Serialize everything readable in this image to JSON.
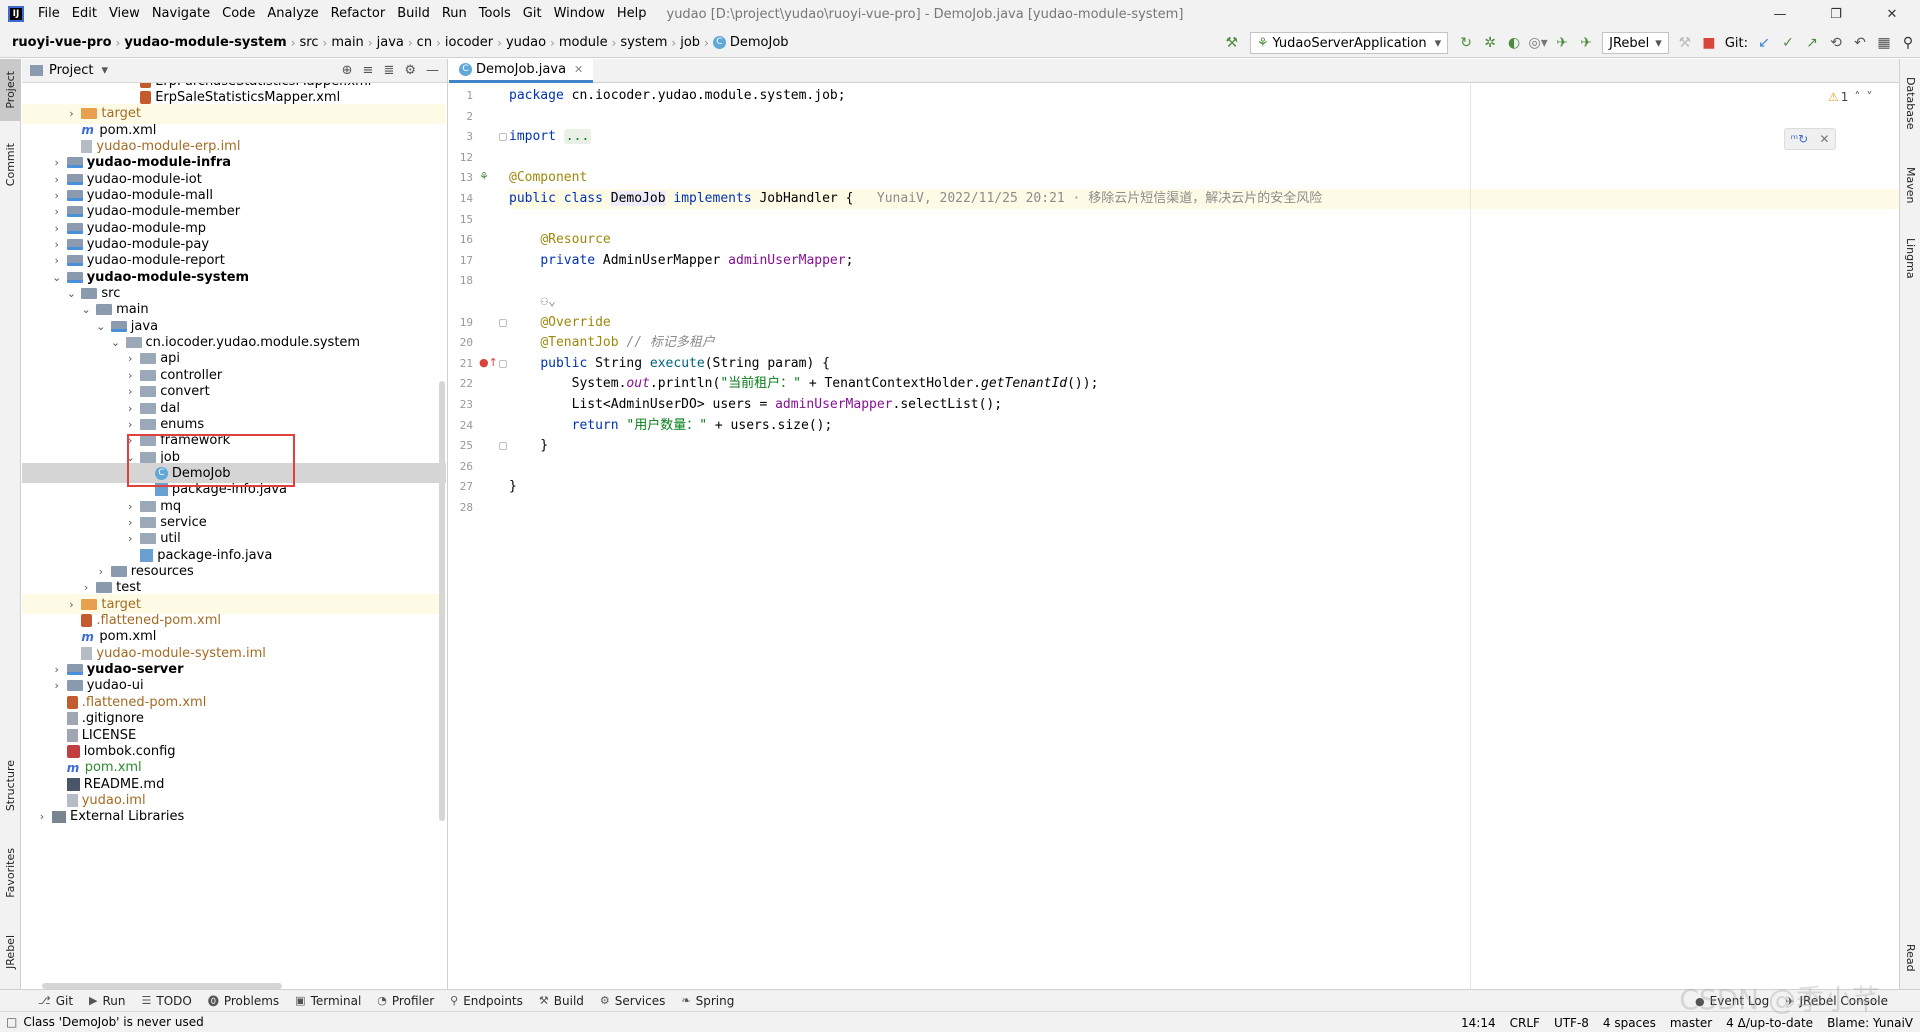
{
  "menubar": {
    "logo": "IJ",
    "items": [
      "File",
      "Edit",
      "View",
      "Navigate",
      "Code",
      "Analyze",
      "Refactor",
      "Build",
      "Run",
      "Tools",
      "Git",
      "Window",
      "Help"
    ],
    "title": "yudao [D:\\project\\yudao\\ruoyi-vue-pro] - DemoJob.java [yudao-module-system]"
  },
  "navbar": {
    "crumbs": [
      "ruoyi-vue-pro",
      "yudao-module-system",
      "src",
      "main",
      "java",
      "cn",
      "iocoder",
      "yudao",
      "module",
      "system",
      "job",
      "DemoJob"
    ],
    "run_config": "YudaoServerApplication",
    "jrebel": "JRebel",
    "git_label": "Git:"
  },
  "left_strip": [
    "Project",
    "Commit",
    "Structure",
    "Favorites",
    "JRebel"
  ],
  "right_strip": [
    "Database",
    "Maven",
    "Lingma",
    "Read"
  ],
  "project": {
    "title": "Project",
    "tree": [
      {
        "label": "ErpPurchaseStatisticsMapper.xml",
        "icon": "xml",
        "indent": 6,
        "chev": "",
        "style": ""
      },
      {
        "label": "ErpSaleStatisticsMapper.xml",
        "icon": "xml",
        "indent": 6,
        "chev": "",
        "style": ""
      },
      {
        "label": "target",
        "icon": "folder-orange",
        "indent": 2,
        "chev": "›",
        "style": "orange",
        "row": "hl-yellow"
      },
      {
        "label": "pom.xml",
        "icon": "maven",
        "indent": 2,
        "chev": "",
        "style": ""
      },
      {
        "label": "yudao-module-erp.iml",
        "icon": "iml",
        "indent": 2,
        "chev": "",
        "style": "orange"
      },
      {
        "label": "yudao-module-infra",
        "icon": "module",
        "indent": 1,
        "chev": "›",
        "style": "bold"
      },
      {
        "label": "yudao-module-iot",
        "icon": "module",
        "indent": 1,
        "chev": "›",
        "style": ""
      },
      {
        "label": "yudao-module-mall",
        "icon": "module",
        "indent": 1,
        "chev": "›",
        "style": ""
      },
      {
        "label": "yudao-module-member",
        "icon": "module",
        "indent": 1,
        "chev": "›",
        "style": ""
      },
      {
        "label": "yudao-module-mp",
        "icon": "module",
        "indent": 1,
        "chev": "›",
        "style": ""
      },
      {
        "label": "yudao-module-pay",
        "icon": "module",
        "indent": 1,
        "chev": "›",
        "style": ""
      },
      {
        "label": "yudao-module-report",
        "icon": "module",
        "indent": 1,
        "chev": "›",
        "style": ""
      },
      {
        "label": "yudao-module-system",
        "icon": "module",
        "indent": 1,
        "chev": "⌄",
        "style": "bold"
      },
      {
        "label": "src",
        "icon": "folder",
        "indent": 2,
        "chev": "⌄",
        "style": ""
      },
      {
        "label": "main",
        "icon": "folder",
        "indent": 3,
        "chev": "⌄",
        "style": ""
      },
      {
        "label": "java",
        "icon": "module",
        "indent": 4,
        "chev": "⌄",
        "style": ""
      },
      {
        "label": "cn.iocoder.yudao.module.system",
        "icon": "pkg",
        "indent": 5,
        "chev": "⌄",
        "style": ""
      },
      {
        "label": "api",
        "icon": "pkg",
        "indent": 6,
        "chev": "›",
        "style": ""
      },
      {
        "label": "controller",
        "icon": "pkg",
        "indent": 6,
        "chev": "›",
        "style": ""
      },
      {
        "label": "convert",
        "icon": "pkg",
        "indent": 6,
        "chev": "›",
        "style": ""
      },
      {
        "label": "dal",
        "icon": "pkg",
        "indent": 6,
        "chev": "›",
        "style": ""
      },
      {
        "label": "enums",
        "icon": "pkg",
        "indent": 6,
        "chev": "›",
        "style": ""
      },
      {
        "label": "framework",
        "icon": "pkg",
        "indent": 6,
        "chev": "›",
        "style": ""
      },
      {
        "label": "job",
        "icon": "pkg",
        "indent": 6,
        "chev": "⌄",
        "style": ""
      },
      {
        "label": "DemoJob",
        "icon": "cls",
        "indent": 7,
        "chev": "",
        "style": "",
        "row": "selected"
      },
      {
        "label": "package-info.java",
        "icon": "java",
        "indent": 7,
        "chev": "",
        "style": ""
      },
      {
        "label": "mq",
        "icon": "pkg",
        "indent": 6,
        "chev": "›",
        "style": ""
      },
      {
        "label": "service",
        "icon": "pkg",
        "indent": 6,
        "chev": "›",
        "style": ""
      },
      {
        "label": "util",
        "icon": "pkg",
        "indent": 6,
        "chev": "›",
        "style": ""
      },
      {
        "label": "package-info.java",
        "icon": "java",
        "indent": 6,
        "chev": "",
        "style": ""
      },
      {
        "label": "resources",
        "icon": "folder",
        "indent": 4,
        "chev": "›",
        "style": ""
      },
      {
        "label": "test",
        "icon": "folder",
        "indent": 3,
        "chev": "›",
        "style": ""
      },
      {
        "label": "target",
        "icon": "folder-orange",
        "indent": 2,
        "chev": "›",
        "style": "orange",
        "row": "hl-yellow"
      },
      {
        "label": ".flattened-pom.xml",
        "icon": "xml",
        "indent": 2,
        "chev": "",
        "style": "orange"
      },
      {
        "label": "pom.xml",
        "icon": "maven",
        "indent": 2,
        "chev": "",
        "style": ""
      },
      {
        "label": "yudao-module-system.iml",
        "icon": "iml",
        "indent": 2,
        "chev": "",
        "style": "orange"
      },
      {
        "label": "yudao-server",
        "icon": "module",
        "indent": 1,
        "chev": "›",
        "style": "bold"
      },
      {
        "label": "yudao-ui",
        "icon": "folder",
        "indent": 1,
        "chev": "›",
        "style": ""
      },
      {
        "label": ".flattened-pom.xml",
        "icon": "xml",
        "indent": 1,
        "chev": "",
        "style": "orange"
      },
      {
        "label": ".gitignore",
        "icon": "txt",
        "indent": 1,
        "chev": "",
        "style": ""
      },
      {
        "label": "LICENSE",
        "icon": "txt",
        "indent": 1,
        "chev": "",
        "style": ""
      },
      {
        "label": "lombok.config",
        "icon": "lombok",
        "indent": 1,
        "chev": "",
        "style": ""
      },
      {
        "label": "pom.xml",
        "icon": "maven",
        "indent": 1,
        "chev": "",
        "style": "green"
      },
      {
        "label": "README.md",
        "icon": "md",
        "indent": 1,
        "chev": "",
        "style": ""
      },
      {
        "label": "yudao.iml",
        "icon": "iml",
        "indent": 1,
        "chev": "",
        "style": "orange"
      },
      {
        "label": "External Libraries",
        "icon": "libs",
        "indent": 0,
        "chev": "›",
        "style": ""
      }
    ]
  },
  "editor": {
    "tab": "DemoJob.java",
    "warning_count": "1",
    "lines": [
      {
        "n": "1",
        "html": "<span class='kw'>package</span> cn.iocoder.yudao.module.system.job;"
      },
      {
        "n": "2",
        "html": ""
      },
      {
        "n": "3",
        "html": "<span class='kw'>import</span> <span class='fold-hint'>...</span>"
      },
      {
        "n": "12",
        "html": ""
      },
      {
        "n": "13",
        "html": "<span class='ann'>@Component</span>"
      },
      {
        "n": "14",
        "html": "<span class='kw'>public class</span> <span style='background:#edebfc'>DemoJob</span> <span class='kw'>implements</span> JobHandler {   <span class='inl'>YunaiV, 2022/11/25 20:21 · 移除云片短信渠道，解决云片的安全风险</span>",
        "cur": true
      },
      {
        "n": "15",
        "html": ""
      },
      {
        "n": "16",
        "html": "    <span class='ann'>@Resource</span>"
      },
      {
        "n": "17",
        "html": "    <span class='kw'>private</span> AdminUserMapper <span class='fld'>adminUserMapper</span>;"
      },
      {
        "n": "18",
        "html": ""
      },
      {
        "n": "",
        "html": "    <span class='inl'>⚇⌄</span>"
      },
      {
        "n": "19",
        "html": "    <span class='ann'>@Override</span>"
      },
      {
        "n": "20",
        "html": "    <span class='ann'>@TenantJob</span> <span class='cmt'>// 标记多租户</span>"
      },
      {
        "n": "21",
        "html": "    <span class='kw'>public</span> String <span style='color:#00627a'>execute</span>(String param) {"
      },
      {
        "n": "22",
        "html": "        System.<span class='fld it'>out</span>.println(<span class='str'>\"当前租户：\"</span> + TenantContextHolder.<span class='it'>getTenantId</span>());"
      },
      {
        "n": "23",
        "html": "        List&lt;AdminUserDO&gt; users = <span class='fld'>adminUserMapper</span>.selectList();"
      },
      {
        "n": "24",
        "html": "        <span class='kw'>return</span> <span class='str'>\"用户数量：\"</span> + users.size();"
      },
      {
        "n": "25",
        "html": "    }"
      },
      {
        "n": "26",
        "html": ""
      },
      {
        "n": "27",
        "html": "}"
      },
      {
        "n": "28",
        "html": ""
      }
    ]
  },
  "bottom_tools": [
    {
      "icon": "⎇",
      "label": "Git"
    },
    {
      "icon": "▶",
      "label": "Run"
    },
    {
      "icon": "☰",
      "label": "TODO"
    },
    {
      "icon": "⓿",
      "label": "Problems"
    },
    {
      "icon": "▣",
      "label": "Terminal"
    },
    {
      "icon": "◔",
      "label": "Profiler"
    },
    {
      "icon": "⚲",
      "label": "Endpoints"
    },
    {
      "icon": "⚒",
      "label": "Build"
    },
    {
      "icon": "⚙",
      "label": "Services"
    },
    {
      "icon": "❧",
      "label": "Spring"
    }
  ],
  "bottom_right": [
    "Event Log",
    "JRebel Console"
  ],
  "status": {
    "message": "Class 'DemoJob' is never used",
    "items": [
      "14:14",
      "CRLF",
      "UTF-8",
      "4 spaces",
      "master",
      "4 Δ/up-to-date",
      "Blame: YunaiV"
    ]
  },
  "watermark": "CSDN @季小芊"
}
